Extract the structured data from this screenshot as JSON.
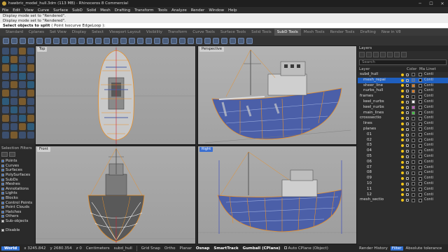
{
  "window": {
    "title": "hawbric_model_hull.3dm (113 MB) - Rhinoceros 8 Commercial"
  },
  "menu": [
    "File",
    "Edit",
    "View",
    "Curve",
    "Surface",
    "SubD",
    "Solid",
    "Mesh",
    "Drafting",
    "Transform",
    "Tools",
    "Analyze",
    "Render",
    "Window",
    "Help"
  ],
  "command_history": [
    "Display mode set to \"Rendered\".",
    "Display mode set to \"Rendered\"."
  ],
  "command_prompt": {
    "text": "Select objects to split",
    "options": "( Point  Isocurve  EdgeLoop ):"
  },
  "tabs": [
    "Standard",
    "Cplanes",
    "Set View",
    "Display",
    "Select",
    "Viewport Layout",
    "Visibility",
    "Transform",
    "Curve Tools",
    "Surface Tools",
    "Solid Tools",
    "SubD Tools",
    "Mesh Tools",
    "Render Tools",
    "Drafting",
    "New in V8"
  ],
  "active_tab": "SubD Tools",
  "viewports": {
    "top": "Top",
    "perspective": "Perspective",
    "front": "Front",
    "right": "Right"
  },
  "selection_filters": {
    "title": "Selection Filters",
    "items": [
      "Points",
      "Curves",
      "Surfaces",
      "PolySurfaces",
      "SubDs",
      "Meshes",
      "Annotations",
      "Lights",
      "Blocks",
      "Control Points",
      "Point Clouds",
      "Hatches",
      "Others",
      "Sub-objects"
    ],
    "disable": "Disable"
  },
  "layers": {
    "title": "Layers",
    "search_placeholder": "Search",
    "headers": {
      "layer": "Layer",
      "color": "Color",
      "material": "Ma",
      "linetype": "Linet"
    },
    "rows": [
      {
        "name": "subd_hull",
        "color": "#1a1a1a",
        "linetype": "Conti",
        "selected": false
      },
      {
        "name": "mesh_repai",
        "color": "#2f6fd3",
        "linetype": "Conti",
        "selected": true
      },
      {
        "name": "sheer_line",
        "color": "#e07b1a",
        "linetype": "Conti",
        "selected": false
      },
      {
        "name": "nurbs_hull",
        "color": "#e07b1a",
        "linetype": "Conti",
        "selected": false
      },
      {
        "name": "frames",
        "color": "#1a1a1a",
        "linetype": "Conti",
        "selected": false
      },
      {
        "name": "keel_nurbs",
        "color": "#ffffff",
        "linetype": "Conti",
        "selected": false
      },
      {
        "name": "keel_nurbs",
        "color": "#c05ac0",
        "linetype": "Conti",
        "selected": false
      },
      {
        "name": "main_lines",
        "color": "#3fbf3f",
        "linetype": "Conti",
        "selected": false
      },
      {
        "name": "crosssectio",
        "color": "#1a1a1a",
        "linetype": "Conti",
        "selected": false
      },
      {
        "name": "lines",
        "color": "#1a1a1a",
        "linetype": "Conti",
        "selected": false
      },
      {
        "name": "planes",
        "color": "#1a1a1a",
        "linetype": "Conti",
        "selected": false
      },
      {
        "name": "01",
        "color": "#1a1a1a",
        "linetype": "Conti",
        "selected": false
      },
      {
        "name": "02",
        "color": "#1a1a1a",
        "linetype": "Conti",
        "selected": false
      },
      {
        "name": "03",
        "color": "#1a1a1a",
        "linetype": "Conti",
        "selected": false
      },
      {
        "name": "04",
        "color": "#1a1a1a",
        "linetype": "Conti",
        "selected": false
      },
      {
        "name": "05",
        "color": "#1a1a1a",
        "linetype": "Conti",
        "selected": false
      },
      {
        "name": "06",
        "color": "#1a1a1a",
        "linetype": "Conti",
        "selected": false
      },
      {
        "name": "07",
        "color": "#1a1a1a",
        "linetype": "Conti",
        "selected": false
      },
      {
        "name": "08",
        "color": "#1a1a1a",
        "linetype": "Conti",
        "selected": false
      },
      {
        "name": "09",
        "color": "#1a1a1a",
        "linetype": "Conti",
        "selected": false
      },
      {
        "name": "10",
        "color": "#1a1a1a",
        "linetype": "Conti",
        "selected": false
      },
      {
        "name": "11",
        "color": "#1a1a1a",
        "linetype": "Conti",
        "selected": false
      },
      {
        "name": "12",
        "color": "#1a1a1a",
        "linetype": "Conti",
        "selected": false
      },
      {
        "name": "mesh_sectio",
        "color": "#1a1a1a",
        "linetype": "Conti",
        "selected": false
      }
    ]
  },
  "panel_tabs": [
    "Render History",
    "Filter",
    "Absolute tolerance"
  ],
  "active_panel_tab": "Filter",
  "status": {
    "cplane": "World",
    "x": "x 3245.842",
    "y": "y 2680.354",
    "z": "z 0",
    "units": "Centimeters",
    "layer": "subd_hull",
    "grid_snap": "Grid Snap",
    "ortho": "Ortho",
    "planar": "Planar",
    "osnap": "Osnap",
    "smarttrack": "SmartTrack",
    "gumball": "Gumball (CPlane)",
    "autocplane": "Auto CPlane (Object)"
  },
  "colors": {
    "accent": "#2f6fd3",
    "hull_blue": "#4b5fa8",
    "wire_orange": "#e8902a"
  }
}
